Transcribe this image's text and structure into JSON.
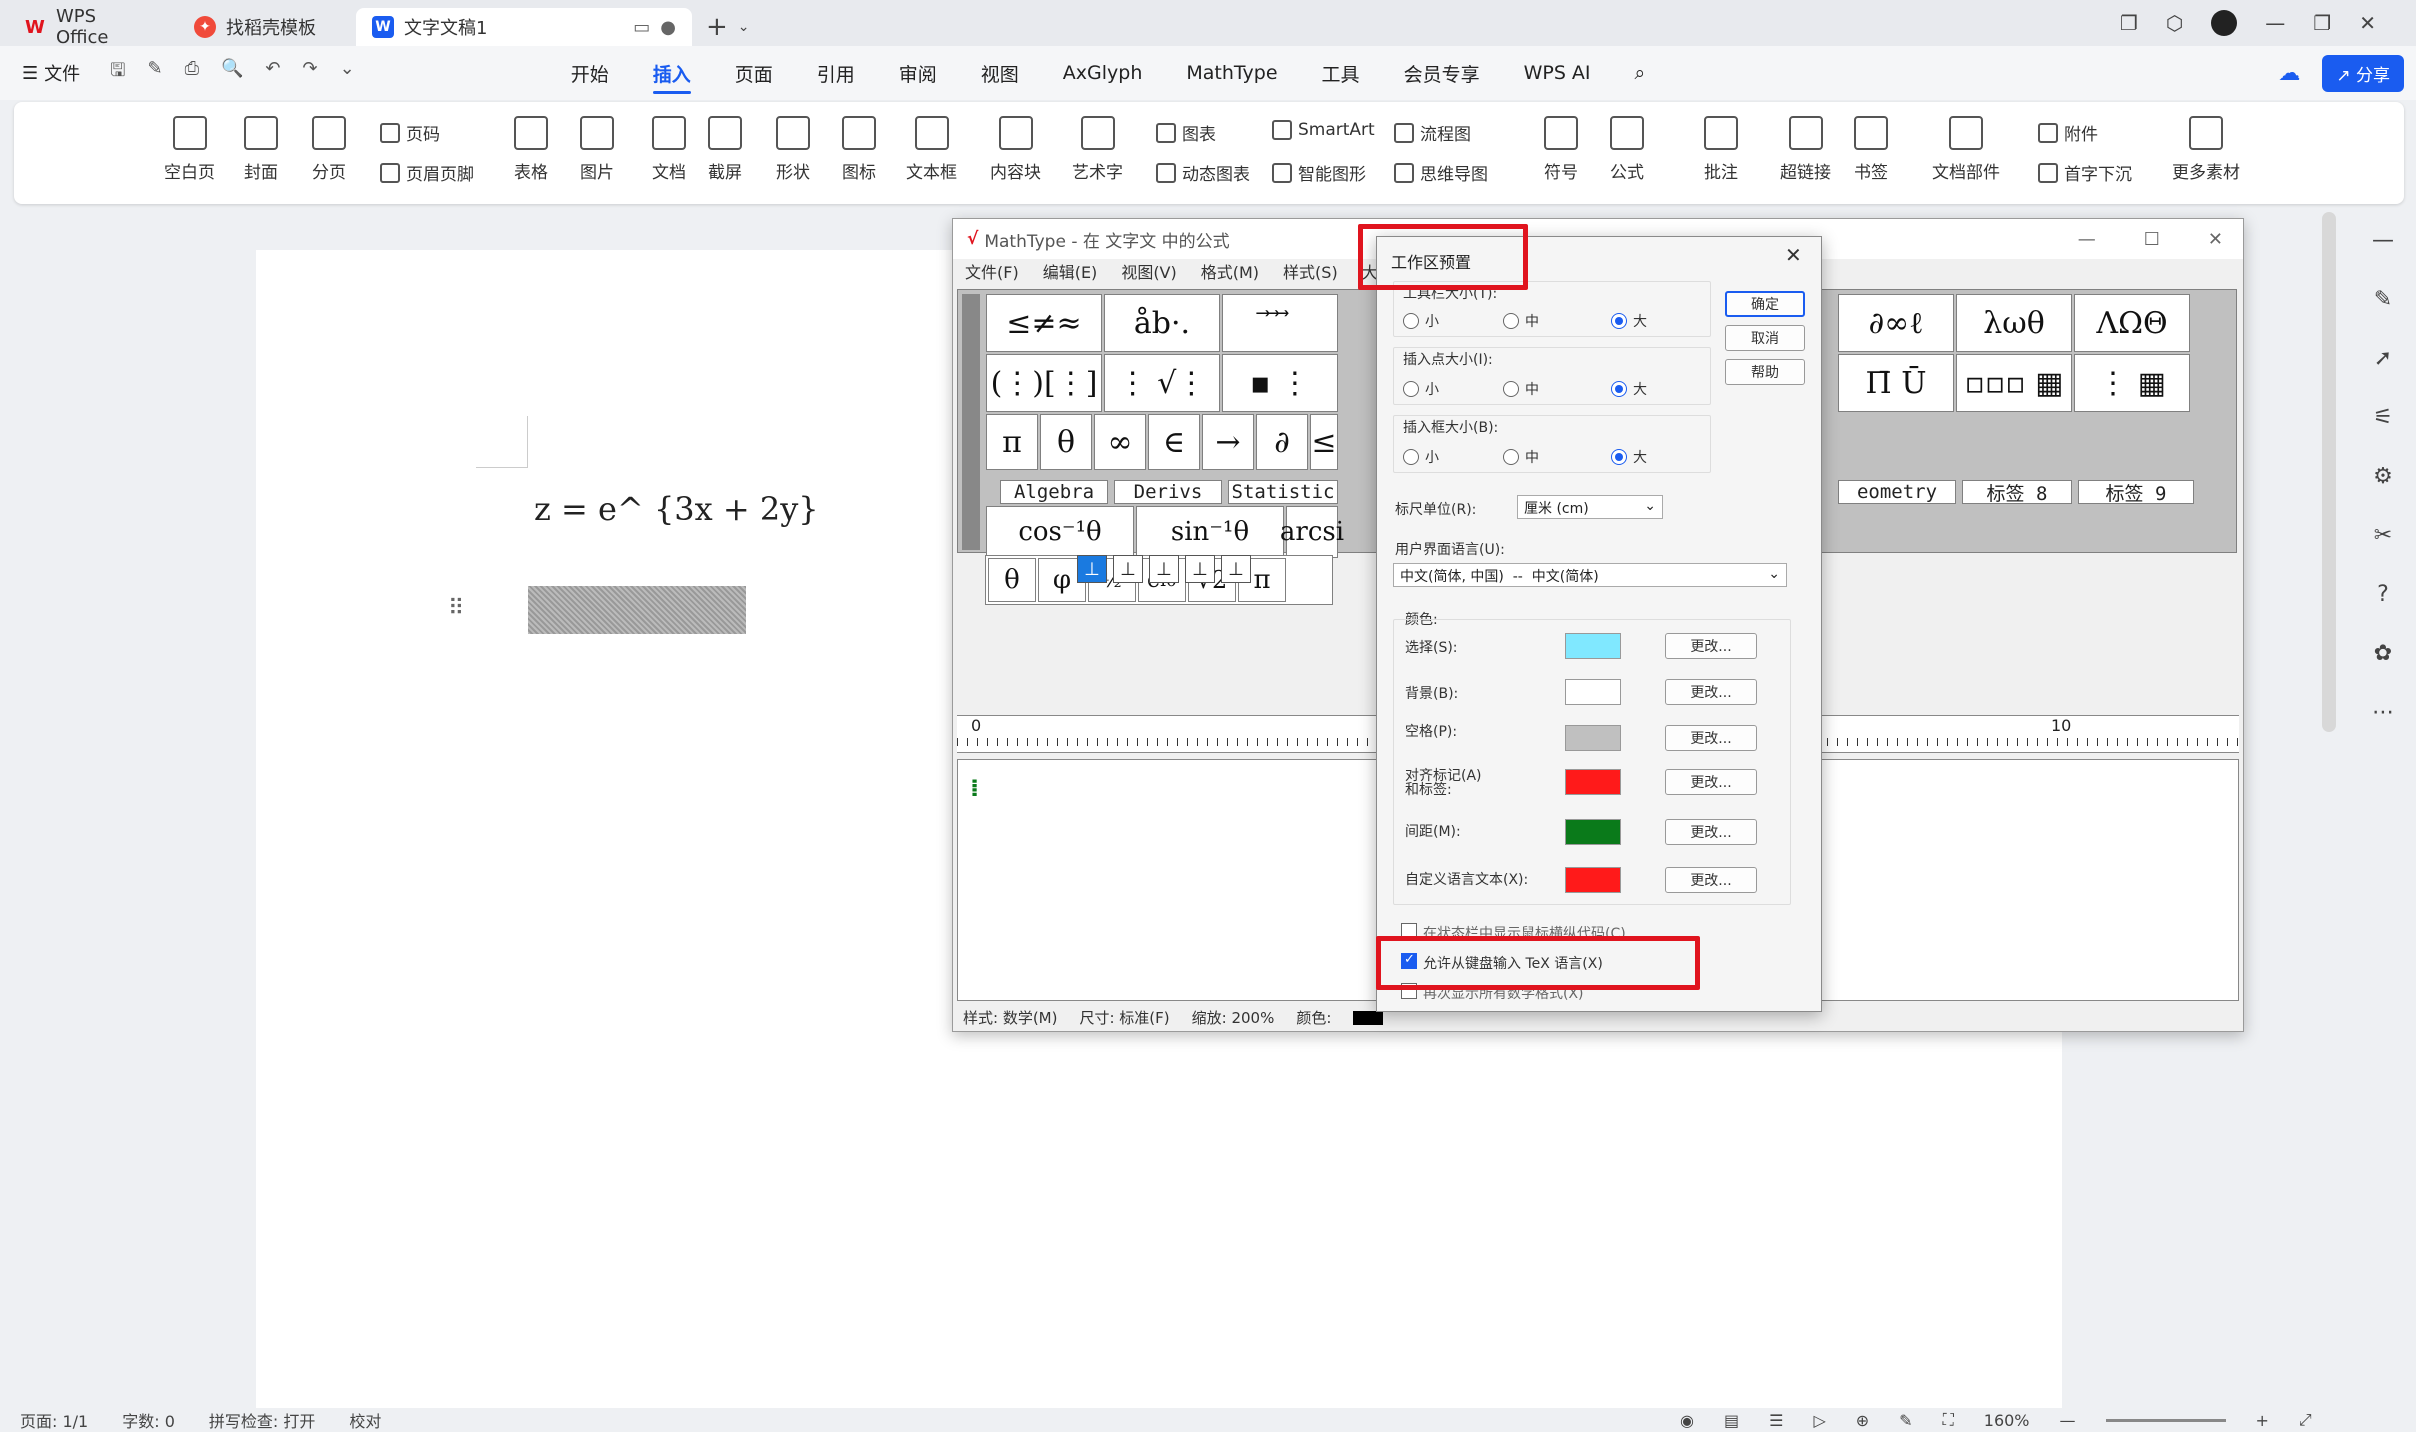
{
  "tabs": [
    {
      "label": "WPS Office"
    },
    {
      "label": "找稻壳模板"
    },
    {
      "label": "文字文稿1"
    }
  ],
  "menubar": {
    "file": "文件",
    "items": [
      "开始",
      "插入",
      "页面",
      "引用",
      "审阅",
      "视图",
      "AxGlyph",
      "MathType",
      "工具",
      "会员专享",
      "WPS AI"
    ],
    "share": "分享"
  },
  "ribbon": {
    "blank_page": "空白页",
    "cover": "封面",
    "page_break": "分页",
    "page_num": "页码",
    "header_footer": "页眉页脚",
    "table": "表格",
    "picture": "图片",
    "doc": "文档",
    "screenshot": "截屏",
    "shape": "形状",
    "icon": "图标",
    "textbox": "文本框",
    "content_block": "内容块",
    "wordart": "艺术字",
    "chart": "图表",
    "dyn_chart": "动态图表",
    "smartart": "SmartArt",
    "smart_shape": "智能图形",
    "flowchart": "流程图",
    "mindmap": "思维导图",
    "symbol": "符号",
    "formula": "公式",
    "comment": "批注",
    "hyperlink": "超链接",
    "bookmark": "书签",
    "doc_parts": "文档部件",
    "attachment": "附件",
    "dropcap": "首字下沉",
    "more": "更多素材"
  },
  "document": {
    "equation": "z = e^ {3x + 2y}"
  },
  "mathtype": {
    "title": "MathType - 在 文字文 中的公式",
    "menu": [
      "文件(F)",
      "编辑(E)",
      "视图(V)",
      "格式(M)",
      "样式(S)",
      "大"
    ],
    "tabs": [
      "Algebra",
      "Derivs",
      "Statistic",
      "eometry",
      "标签 8",
      "标签 9"
    ],
    "status": {
      "style": "样式: 数学(M)",
      "size": "尺寸: 标准(F)",
      "zoom": "缩放: 200%",
      "color": "颜色:"
    },
    "ruler_0": "0",
    "ruler_10": "10"
  },
  "dialog": {
    "title": "工作区预置",
    "ok": "确定",
    "cancel": "取消",
    "help": "帮助",
    "toolbar_size": "工具栏大小(T):",
    "insert_point_size": "插入点大小(I):",
    "insert_box_size": "插入框大小(B):",
    "small": "小",
    "medium": "中",
    "large": "大",
    "ruler_unit_label": "标尺单位(R):",
    "ruler_unit_value": "厘米 (cm)",
    "ui_lang_label": "用户界面语言(U):",
    "ui_lang_value": "中文(简体, 中国)  --  中文(简体)",
    "colors_label": "颜色:",
    "color_rows": [
      {
        "label": "选择(S):",
        "color": "#80e8ff"
      },
      {
        "label": "背景(B):",
        "color": "#ffffff"
      },
      {
        "label": "空格(P):",
        "color": "#c0c0c0"
      },
      {
        "label": "对齐标记(A)\n和标签:",
        "color": "#ff1a1a"
      },
      {
        "label": "间距(M):",
        "color": "#0a7a1a"
      },
      {
        "label": "自定义语言文本(X):",
        "color": "#ff1a1a"
      }
    ],
    "change": "更改...",
    "chk1": "在状态栏中显示鼠标横纵代码(C)",
    "chk2": "允许从键盘输入 TeX 语言(X)",
    "chk3": "再次显示所有数学格式(X)"
  },
  "status": {
    "page": "页面: 1/1",
    "words": "字数: 0",
    "spell": "拼写检查: 打开",
    "proof": "校对",
    "zoom": "160%"
  }
}
